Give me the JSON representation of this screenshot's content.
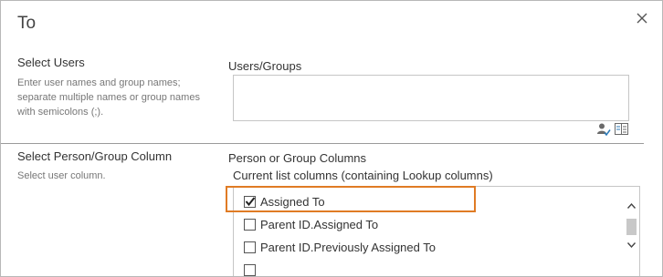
{
  "dialog": {
    "title": "To",
    "close_icon": "close-icon"
  },
  "select_users": {
    "title": "Select Users",
    "description_lines": [
      "Enter user names and group names;",
      "separate multiple names or group names",
      "with semicolons (;)."
    ],
    "field_label": "Users/Groups",
    "value": "",
    "icons": [
      "check-names-icon",
      "address-book-icon"
    ]
  },
  "person_group_column": {
    "title": "Select Person/Group Column",
    "description": "Select user column.",
    "field_label": "Person or Group Columns",
    "list_caption": "Current list columns (containing Lookup columns)",
    "options": [
      {
        "label": "Assigned To",
        "checked": true
      },
      {
        "label": "Parent ID.Assigned To",
        "checked": false
      },
      {
        "label": "Parent ID.Previously Assigned To",
        "checked": false
      }
    ]
  },
  "colors": {
    "highlight": "#e07b24",
    "border": "#c6c6c6",
    "divider": "#9a9a9a"
  }
}
